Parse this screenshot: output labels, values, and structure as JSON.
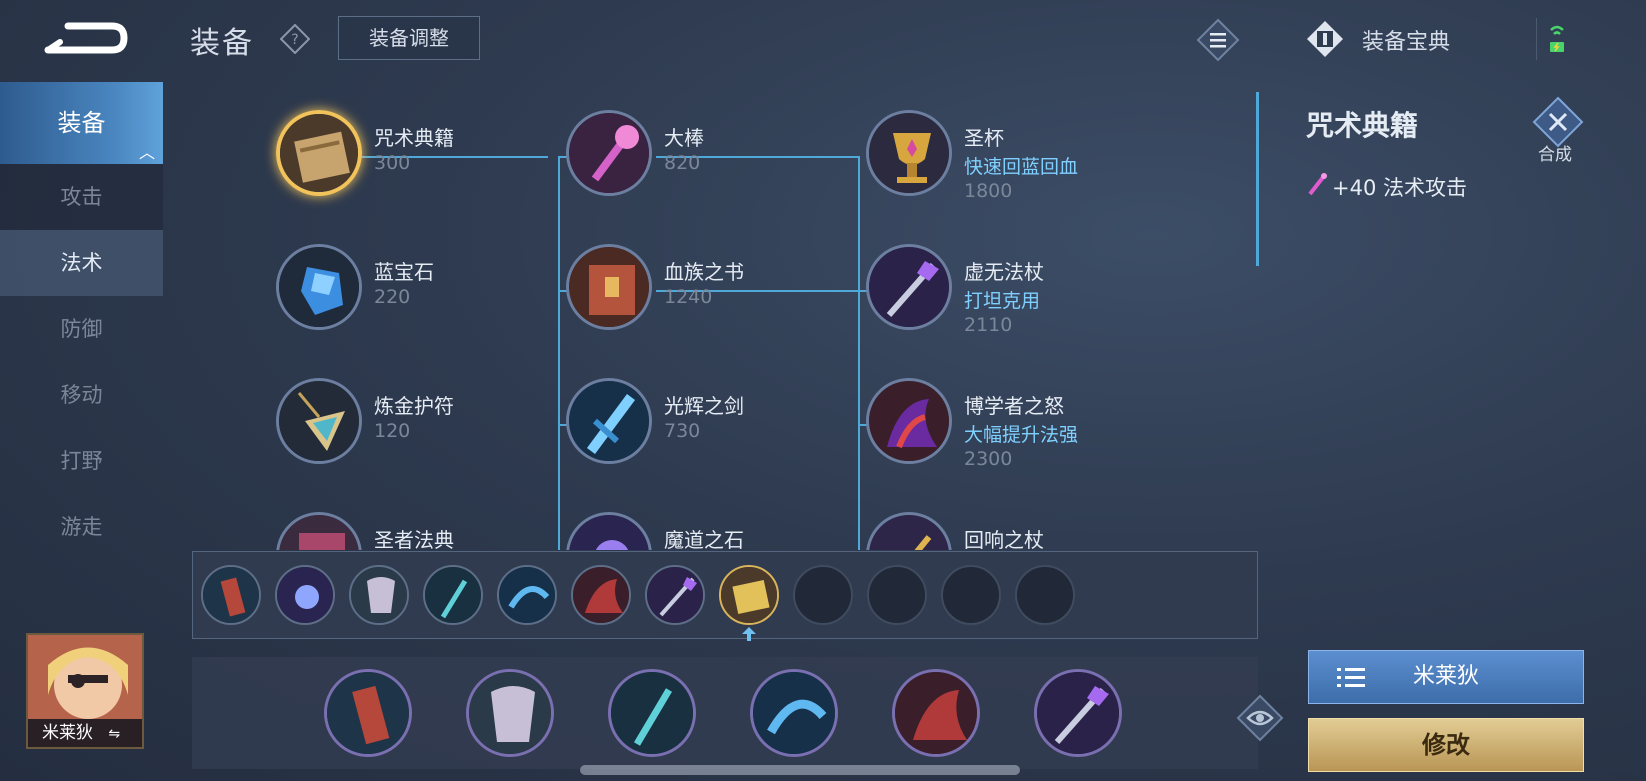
{
  "header": {
    "title": "装备",
    "adjust_label": "装备调整",
    "codex_label": "装备宝典"
  },
  "sidebar": {
    "items": [
      {
        "label": "装备"
      },
      {
        "label": "攻击"
      },
      {
        "label": "法术"
      },
      {
        "label": "防御"
      },
      {
        "label": "移动"
      },
      {
        "label": "打野"
      },
      {
        "label": "游走"
      }
    ]
  },
  "hero": {
    "name": "米莱狄"
  },
  "tree": {
    "col1": [
      {
        "name": "咒术典籍",
        "price": "300"
      },
      {
        "name": "蓝宝石",
        "price": "220"
      },
      {
        "name": "炼金护符",
        "price": "120"
      },
      {
        "name": "圣者法典"
      }
    ],
    "col2": [
      {
        "name": "大棒",
        "price": "820"
      },
      {
        "name": "血族之书",
        "price": "1240"
      },
      {
        "name": "光辉之剑",
        "price": "730"
      },
      {
        "name": "魔道之石"
      }
    ],
    "col3": [
      {
        "name": "圣杯",
        "effect": "快速回蓝回血",
        "price": "1800"
      },
      {
        "name": "虚无法杖",
        "effect": "打坦克用",
        "price": "2110"
      },
      {
        "name": "博学者之怒",
        "effect": "大幅提升法强",
        "price": "2300"
      },
      {
        "name": "回响之杖"
      }
    ]
  },
  "detail": {
    "title": "咒术典籍",
    "compose_label": "合成",
    "stat": "+40 法术攻击"
  },
  "buttons": {
    "build_label": "米莱狄",
    "modify_label": "修改"
  },
  "colors": {
    "accent_blue": "#4fa8d8",
    "effect_text": "#7fd0ff",
    "gold": "#f2c35a"
  }
}
